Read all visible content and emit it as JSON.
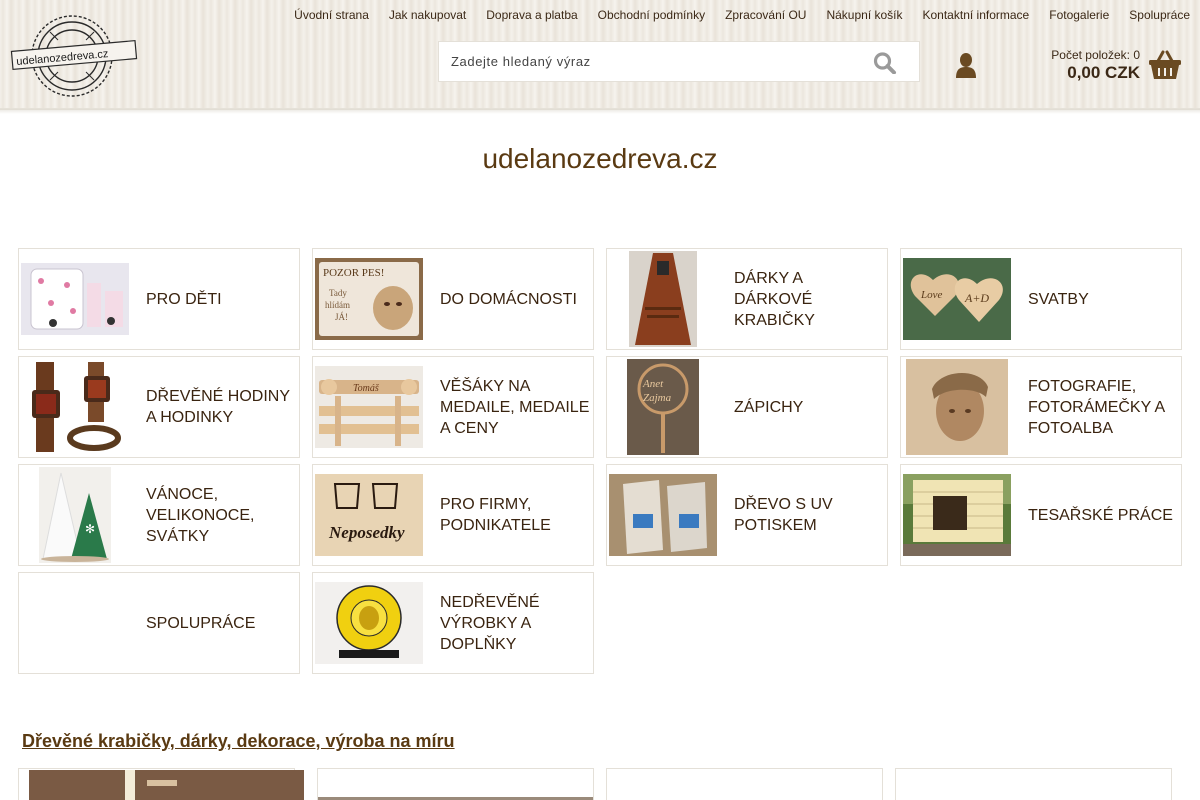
{
  "header": {
    "logo_text": "udelanozedreva.cz",
    "nav": [
      "Úvodní strana",
      "Jak nakupovat",
      "Doprava a platba",
      "Obchodní podmínky",
      "Zpracování OU",
      "Nákupní košík",
      "Kontaktní informace",
      "Fotogalerie",
      "Spolupráce"
    ],
    "search": {
      "placeholder": "Zadejte hledaný výraz"
    },
    "cart": {
      "count_label": "Počet položek: 0",
      "total": "0,00 CZK"
    }
  },
  "main": {
    "site_title": "udelanozedreva.cz",
    "categories": [
      {
        "label": "PRO DĚTI",
        "thumb": "kids-clock-photo"
      },
      {
        "label": "DO DOMÁCNOSTI",
        "thumb": "dog-sign-photo"
      },
      {
        "label": "DÁRKY A DÁRKOVÉ KRABIČKY",
        "thumb": "bottle-opener-photo"
      },
      {
        "label": "SVATBY",
        "thumb": "wedding-hearts-photo"
      },
      {
        "label": "DŘEVĚNÉ HODINY A HODINKY",
        "thumb": "wooden-watch-photo"
      },
      {
        "label": "VĚŠÁKY NA MEDAILE, MEDAILE A CENY",
        "thumb": "medal-hanger-photo"
      },
      {
        "label": "ZÁPICHY",
        "thumb": "cake-topper-photo"
      },
      {
        "label": "FOTOGRAFIE, FOTORÁMEČKY A FOTOALBA",
        "thumb": "engraved-photo"
      },
      {
        "label": "VÁNOCE, VELIKONOCE, SVÁTKY",
        "thumb": "christmas-trees-photo"
      },
      {
        "label": "PRO FIRMY, PODNIKATELE",
        "thumb": "company-sign-photo"
      },
      {
        "label": "DŘEVO S UV POTISKEM",
        "thumb": "uv-print-photo"
      },
      {
        "label": "TESAŘSKÉ PRÁCE",
        "thumb": "doghouse-photo"
      },
      {
        "label": "SPOLUPRÁCE",
        "thumb": ""
      },
      {
        "label": "NEDŘEVĚNÉ VÝROBKY A DOPLŇKY",
        "thumb": "yellow-stand-photo"
      }
    ],
    "section_link": "Dřevěné krabičky, dárky, dekorace, výroba na míru"
  },
  "colors": {
    "brand_brown": "#5a3a12",
    "text": "#3a2410",
    "border": "#e4e0d8"
  }
}
